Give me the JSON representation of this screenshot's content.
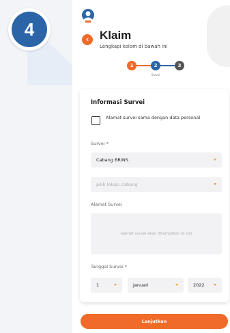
{
  "step_badge": {
    "number": "4"
  },
  "header": {
    "title": "Klaim",
    "subtitle": "Lengkapi kolom di bawah ini",
    "back_icon": "chevron-left-icon"
  },
  "stepper": {
    "steps": [
      {
        "number": "1",
        "color": "#f06b2a",
        "label": ""
      },
      {
        "number": "2",
        "color": "#2b65a8",
        "label": "Survei"
      },
      {
        "number": "3",
        "color": "#555555",
        "label": ""
      }
    ]
  },
  "form": {
    "heading": "Informasi Survei",
    "checkbox_label": "Alamat survei sama dengan data personal",
    "survei_label": "Survei *",
    "survei_value": "Cabang BRINS",
    "lokasi_placeholder": "pilih lokasi cabang",
    "alamat_label": "Alamat Survei",
    "alamat_placeholder": "alamat survei akan ditampilkan di sini",
    "tanggal_label": "Tanggal Survei *",
    "day_value": "1",
    "month_value": "Januari",
    "year_value": "2022"
  },
  "submit_label": "Lanjutkan",
  "colors": {
    "accent": "#f06b2a",
    "primary": "#2b65a8"
  }
}
